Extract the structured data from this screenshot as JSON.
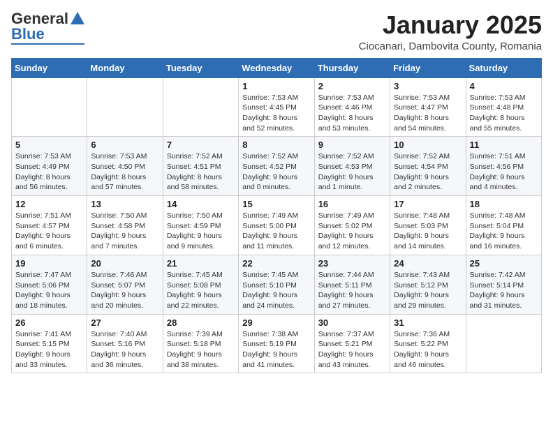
{
  "logo": {
    "general": "General",
    "blue": "Blue"
  },
  "title": {
    "month_year": "January 2025",
    "location": "Ciocanari, Dambovita County, Romania"
  },
  "weekdays": [
    "Sunday",
    "Monday",
    "Tuesday",
    "Wednesday",
    "Thursday",
    "Friday",
    "Saturday"
  ],
  "weeks": [
    [
      {
        "day": "",
        "info": ""
      },
      {
        "day": "",
        "info": ""
      },
      {
        "day": "",
        "info": ""
      },
      {
        "day": "1",
        "info": "Sunrise: 7:53 AM\nSunset: 4:45 PM\nDaylight: 8 hours\nand 52 minutes."
      },
      {
        "day": "2",
        "info": "Sunrise: 7:53 AM\nSunset: 4:46 PM\nDaylight: 8 hours\nand 53 minutes."
      },
      {
        "day": "3",
        "info": "Sunrise: 7:53 AM\nSunset: 4:47 PM\nDaylight: 8 hours\nand 54 minutes."
      },
      {
        "day": "4",
        "info": "Sunrise: 7:53 AM\nSunset: 4:48 PM\nDaylight: 8 hours\nand 55 minutes."
      }
    ],
    [
      {
        "day": "5",
        "info": "Sunrise: 7:53 AM\nSunset: 4:49 PM\nDaylight: 8 hours\nand 56 minutes."
      },
      {
        "day": "6",
        "info": "Sunrise: 7:53 AM\nSunset: 4:50 PM\nDaylight: 8 hours\nand 57 minutes."
      },
      {
        "day": "7",
        "info": "Sunrise: 7:52 AM\nSunset: 4:51 PM\nDaylight: 8 hours\nand 58 minutes."
      },
      {
        "day": "8",
        "info": "Sunrise: 7:52 AM\nSunset: 4:52 PM\nDaylight: 9 hours\nand 0 minutes."
      },
      {
        "day": "9",
        "info": "Sunrise: 7:52 AM\nSunset: 4:53 PM\nDaylight: 9 hours\nand 1 minute."
      },
      {
        "day": "10",
        "info": "Sunrise: 7:52 AM\nSunset: 4:54 PM\nDaylight: 9 hours\nand 2 minutes."
      },
      {
        "day": "11",
        "info": "Sunrise: 7:51 AM\nSunset: 4:56 PM\nDaylight: 9 hours\nand 4 minutes."
      }
    ],
    [
      {
        "day": "12",
        "info": "Sunrise: 7:51 AM\nSunset: 4:57 PM\nDaylight: 9 hours\nand 6 minutes."
      },
      {
        "day": "13",
        "info": "Sunrise: 7:50 AM\nSunset: 4:58 PM\nDaylight: 9 hours\nand 7 minutes."
      },
      {
        "day": "14",
        "info": "Sunrise: 7:50 AM\nSunset: 4:59 PM\nDaylight: 9 hours\nand 9 minutes."
      },
      {
        "day": "15",
        "info": "Sunrise: 7:49 AM\nSunset: 5:00 PM\nDaylight: 9 hours\nand 11 minutes."
      },
      {
        "day": "16",
        "info": "Sunrise: 7:49 AM\nSunset: 5:02 PM\nDaylight: 9 hours\nand 12 minutes."
      },
      {
        "day": "17",
        "info": "Sunrise: 7:48 AM\nSunset: 5:03 PM\nDaylight: 9 hours\nand 14 minutes."
      },
      {
        "day": "18",
        "info": "Sunrise: 7:48 AM\nSunset: 5:04 PM\nDaylight: 9 hours\nand 16 minutes."
      }
    ],
    [
      {
        "day": "19",
        "info": "Sunrise: 7:47 AM\nSunset: 5:06 PM\nDaylight: 9 hours\nand 18 minutes."
      },
      {
        "day": "20",
        "info": "Sunrise: 7:46 AM\nSunset: 5:07 PM\nDaylight: 9 hours\nand 20 minutes."
      },
      {
        "day": "21",
        "info": "Sunrise: 7:45 AM\nSunset: 5:08 PM\nDaylight: 9 hours\nand 22 minutes."
      },
      {
        "day": "22",
        "info": "Sunrise: 7:45 AM\nSunset: 5:10 PM\nDaylight: 9 hours\nand 24 minutes."
      },
      {
        "day": "23",
        "info": "Sunrise: 7:44 AM\nSunset: 5:11 PM\nDaylight: 9 hours\nand 27 minutes."
      },
      {
        "day": "24",
        "info": "Sunrise: 7:43 AM\nSunset: 5:12 PM\nDaylight: 9 hours\nand 29 minutes."
      },
      {
        "day": "25",
        "info": "Sunrise: 7:42 AM\nSunset: 5:14 PM\nDaylight: 9 hours\nand 31 minutes."
      }
    ],
    [
      {
        "day": "26",
        "info": "Sunrise: 7:41 AM\nSunset: 5:15 PM\nDaylight: 9 hours\nand 33 minutes."
      },
      {
        "day": "27",
        "info": "Sunrise: 7:40 AM\nSunset: 5:16 PM\nDaylight: 9 hours\nand 36 minutes."
      },
      {
        "day": "28",
        "info": "Sunrise: 7:39 AM\nSunset: 5:18 PM\nDaylight: 9 hours\nand 38 minutes."
      },
      {
        "day": "29",
        "info": "Sunrise: 7:38 AM\nSunset: 5:19 PM\nDaylight: 9 hours\nand 41 minutes."
      },
      {
        "day": "30",
        "info": "Sunrise: 7:37 AM\nSunset: 5:21 PM\nDaylight: 9 hours\nand 43 minutes."
      },
      {
        "day": "31",
        "info": "Sunrise: 7:36 AM\nSunset: 5:22 PM\nDaylight: 9 hours\nand 46 minutes."
      },
      {
        "day": "",
        "info": ""
      }
    ]
  ]
}
